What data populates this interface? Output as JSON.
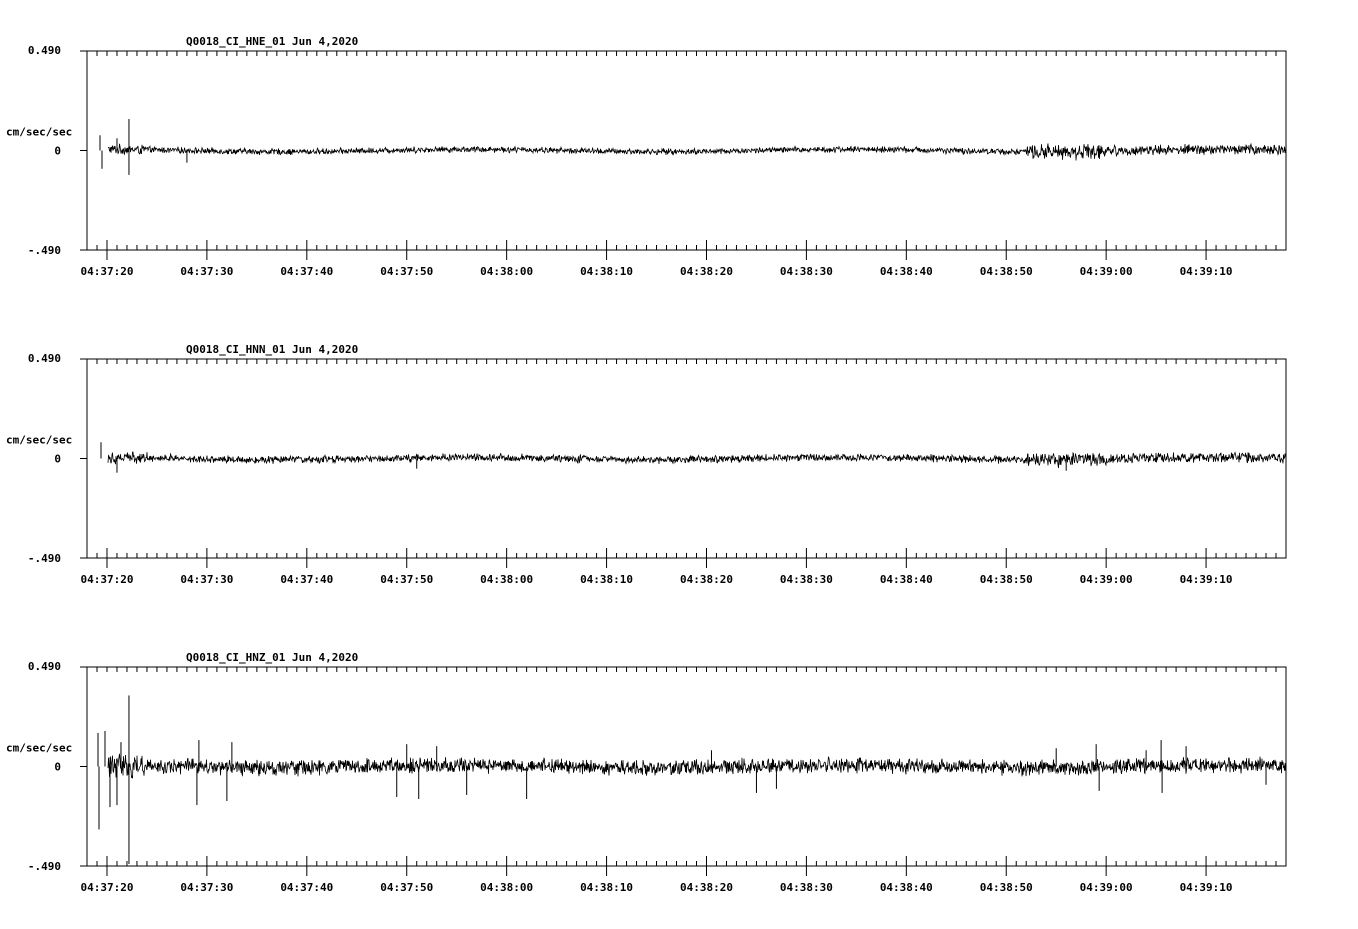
{
  "chart_data": [
    {
      "type": "line",
      "title": "Q0018_CI_HNE_01  Jun 4,2020",
      "ylabel": "cm/sec/sec",
      "ylim": [
        -0.49,
        0.49
      ],
      "yticks": [
        "0.490",
        "0",
        "-.490"
      ],
      "xlim": [
        "04:37:18",
        "04:39:18"
      ],
      "xtick_labels": [
        "04:37:20",
        "04:37:30",
        "04:37:40",
        "04:37:50",
        "04:38:00",
        "04:38:10",
        "04:38:20",
        "04:38:30",
        "04:38:40",
        "04:38:50",
        "04:39:00",
        "04:39:10"
      ],
      "grid": false,
      "series": [
        {
          "signal_start": "04:37:19",
          "noise_amplitude": 0.018,
          "spikes": [
            {
              "t": "04:37:19.3",
              "v": 0.075
            },
            {
              "t": "04:37:19.5",
              "v": -0.09
            },
            {
              "t": "04:37:21",
              "v": 0.06
            },
            {
              "t": "04:37:22.2",
              "v": 0.155
            },
            {
              "t": "04:37:22.2",
              "v": -0.12
            },
            {
              "t": "04:37:28",
              "v": -0.06
            }
          ],
          "bursts": [
            {
              "from": "04:38:52",
              "to": "04:39:00",
              "amplitude": 0.045
            },
            {
              "from": "04:39:00",
              "to": "04:39:18",
              "amplitude": 0.03
            }
          ]
        }
      ]
    },
    {
      "type": "line",
      "title": "Q0018_CI_HNN_01  Jun 4,2020",
      "ylabel": "cm/sec/sec",
      "ylim": [
        -0.49,
        0.49
      ],
      "yticks": [
        "0.490",
        "0",
        "-.490"
      ],
      "xlim": [
        "04:37:18",
        "04:39:18"
      ],
      "xtick_labels": [
        "04:37:20",
        "04:37:30",
        "04:37:40",
        "04:37:50",
        "04:38:00",
        "04:38:10",
        "04:38:20",
        "04:38:30",
        "04:38:40",
        "04:38:50",
        "04:39:00",
        "04:39:10"
      ],
      "grid": false,
      "series": [
        {
          "signal_start": "04:37:19",
          "noise_amplitude": 0.022,
          "spikes": [
            {
              "t": "04:37:19.4",
              "v": 0.08
            },
            {
              "t": "04:37:21",
              "v": -0.07
            },
            {
              "t": "04:37:51",
              "v": -0.05
            },
            {
              "t": "04:38:56",
              "v": -0.06
            }
          ],
          "bursts": [
            {
              "from": "04:38:52",
              "to": "04:39:00",
              "amplitude": 0.045
            },
            {
              "from": "04:39:00",
              "to": "04:39:18",
              "amplitude": 0.03
            }
          ]
        }
      ]
    },
    {
      "type": "line",
      "title": "Q0018_CI_HNZ_01  Jun 4,2020",
      "ylabel": "cm/sec/sec",
      "ylim": [
        -0.49,
        0.49
      ],
      "yticks": [
        "0.490",
        "0",
        "-.490"
      ],
      "xlim": [
        "04:37:18",
        "04:39:18"
      ],
      "xtick_labels": [
        "04:37:20",
        "04:37:30",
        "04:37:40",
        "04:37:50",
        "04:38:00",
        "04:38:10",
        "04:38:20",
        "04:38:30",
        "04:38:40",
        "04:38:50",
        "04:39:00",
        "04:39:10"
      ],
      "grid": false,
      "series": [
        {
          "signal_start": "04:37:19",
          "noise_amplitude": 0.045,
          "spikes": [
            {
              "t": "04:37:19.1",
              "v": 0.165
            },
            {
              "t": "04:37:19.2",
              "v": -0.31
            },
            {
              "t": "04:37:19.8",
              "v": 0.175
            },
            {
              "t": "04:37:20.3",
              "v": -0.2
            },
            {
              "t": "04:37:21",
              "v": -0.19
            },
            {
              "t": "04:37:21.4",
              "v": 0.12
            },
            {
              "t": "04:37:22.2",
              "v": 0.35
            },
            {
              "t": "04:37:22.2",
              "v": -0.48
            },
            {
              "t": "04:37:29",
              "v": -0.19
            },
            {
              "t": "04:37:29.2",
              "v": 0.13
            },
            {
              "t": "04:37:32",
              "v": -0.17
            },
            {
              "t": "04:37:32.5",
              "v": 0.12
            },
            {
              "t": "04:37:49",
              "v": -0.15
            },
            {
              "t": "04:37:50",
              "v": 0.11
            },
            {
              "t": "04:37:51.2",
              "v": -0.16
            },
            {
              "t": "04:37:53",
              "v": 0.1
            },
            {
              "t": "04:37:56",
              "v": -0.14
            },
            {
              "t": "04:38:02",
              "v": -0.16
            },
            {
              "t": "04:38:20.5",
              "v": 0.08
            },
            {
              "t": "04:38:25",
              "v": -0.13
            },
            {
              "t": "04:38:27",
              "v": -0.11
            },
            {
              "t": "04:38:55",
              "v": 0.09
            },
            {
              "t": "04:38:59",
              "v": 0.11
            },
            {
              "t": "04:38:59.3",
              "v": -0.12
            },
            {
              "t": "04:39:04",
              "v": 0.08
            },
            {
              "t": "04:39:05.5",
              "v": 0.13
            },
            {
              "t": "04:39:05.6",
              "v": -0.13
            },
            {
              "t": "04:39:08",
              "v": 0.1
            },
            {
              "t": "04:39:16",
              "v": -0.09
            }
          ],
          "bursts": []
        }
      ]
    }
  ]
}
